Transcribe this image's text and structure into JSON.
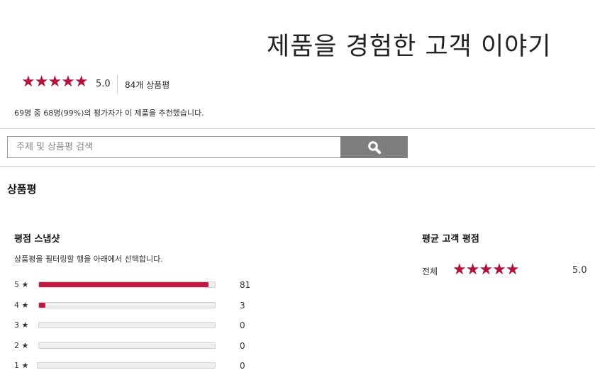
{
  "header": {
    "title": "제품을 경험한 고객 이야기"
  },
  "summary": {
    "stars": "★★★★★",
    "rating": "5.0",
    "review_count": "84개 상품평",
    "recommend_text": "69명 중 68명(99%)의 평가자가 이 제품을 추천했습니다."
  },
  "search": {
    "placeholder": "주제 및 상품평 검색",
    "value": "",
    "button_icon": "search-icon"
  },
  "reviews_section": {
    "title": "상품평"
  },
  "snapshot": {
    "title": "평점 스냅샷",
    "hint": "상품평을 필터링할 행을 아래에서 선택합니다.",
    "rows": [
      {
        "label": "5 ★",
        "count": "81",
        "fraction": 0.964
      },
      {
        "label": "4 ★",
        "count": "3",
        "fraction": 0.036
      },
      {
        "label": "3 ★",
        "count": "0",
        "fraction": 0
      },
      {
        "label": "2 ★",
        "count": "0",
        "fraction": 0
      },
      {
        "label": "1 ★",
        "count": "0",
        "fraction": 0
      }
    ]
  },
  "average": {
    "title": "평균 고객 평점",
    "label": "전체",
    "stars": "★★★★★",
    "value": "5.0"
  },
  "colors": {
    "star": "#b5103c",
    "bar_fill": "#c01a45",
    "search_button": "#7e7e7e"
  }
}
